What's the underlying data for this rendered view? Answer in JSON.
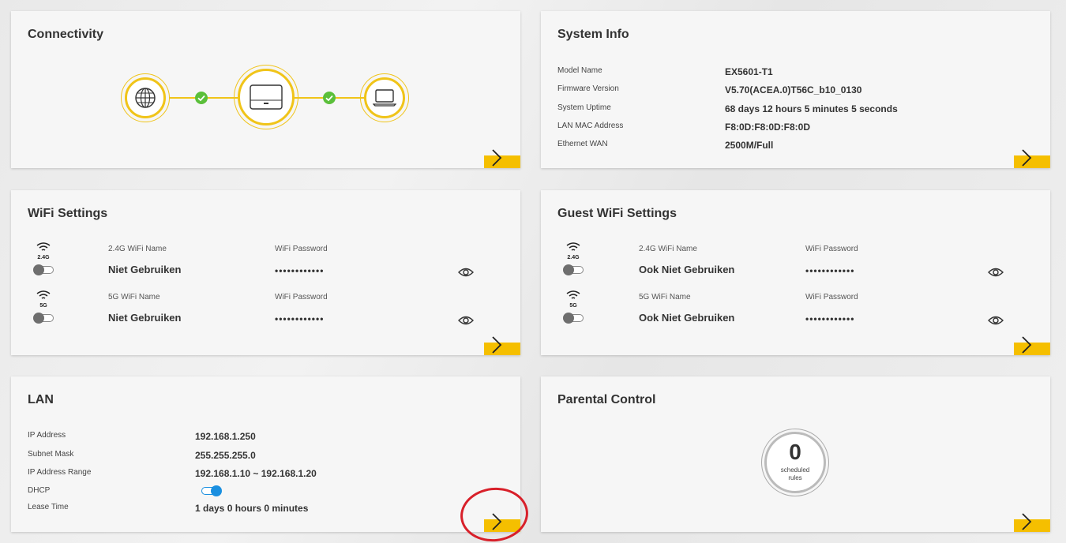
{
  "connectivity": {
    "title": "Connectivity",
    "nodes": [
      "globe-icon",
      "router-icon",
      "laptop-icon"
    ],
    "status_icon": "check-icon"
  },
  "system_info": {
    "title": "System Info",
    "rows": [
      {
        "label": "Model Name",
        "value": "EX5601-T1"
      },
      {
        "label": "Firmware Version",
        "value": "V5.70(ACEA.0)T56C_b10_0130"
      },
      {
        "label": "System Uptime",
        "value": "68 days 12 hours 5 minutes 5 seconds"
      },
      {
        "label": "LAN MAC Address",
        "value": "F8:0D:F8:0D:F8:0D"
      },
      {
        "label": "Ethernet WAN",
        "value": "2500M/Full"
      }
    ]
  },
  "wifi": {
    "title": "WiFi Settings",
    "bands": [
      {
        "band": "2.4G",
        "name_label": "2.4G WiFi Name",
        "name": "Niet Gebruiken",
        "pw_label": "WiFi Password",
        "pw": "••••••••••••",
        "enabled": false
      },
      {
        "band": "5G",
        "name_label": "5G WiFi Name",
        "name": "Niet Gebruiken",
        "pw_label": "WiFi Password",
        "pw": "••••••••••••",
        "enabled": false
      }
    ]
  },
  "guest_wifi": {
    "title": "Guest WiFi Settings",
    "bands": [
      {
        "band": "2.4G",
        "name_label": "2.4G WiFi Name",
        "name": "Ook Niet Gebruiken",
        "pw_label": "WiFi Password",
        "pw": "••••••••••••",
        "enabled": false
      },
      {
        "band": "5G",
        "name_label": "5G WiFi Name",
        "name": "Ook Niet Gebruiken",
        "pw_label": "WiFi Password",
        "pw": "••••••••••••",
        "enabled": false
      }
    ]
  },
  "lan": {
    "title": "LAN",
    "rows": [
      {
        "label": "IP Address",
        "value": "192.168.1.250"
      },
      {
        "label": "Subnet Mask",
        "value": "255.255.255.0"
      },
      {
        "label": "IP Address Range",
        "value": "192.168.1.10 ~ 192.168.1.20"
      },
      {
        "label": "DHCP",
        "value": ""
      },
      {
        "label": "Lease Time",
        "value": "1 days 0 hours 0 minutes"
      }
    ],
    "dhcp_enabled": true
  },
  "parental": {
    "title": "Parental Control",
    "count": "0",
    "count_label_1": "scheduled",
    "count_label_2": "rules"
  },
  "colors": {
    "accent": "#f5bf00",
    "toggle_on": "#1a8fe0",
    "check": "#5bbf3a",
    "highlight": "#d8202a"
  }
}
